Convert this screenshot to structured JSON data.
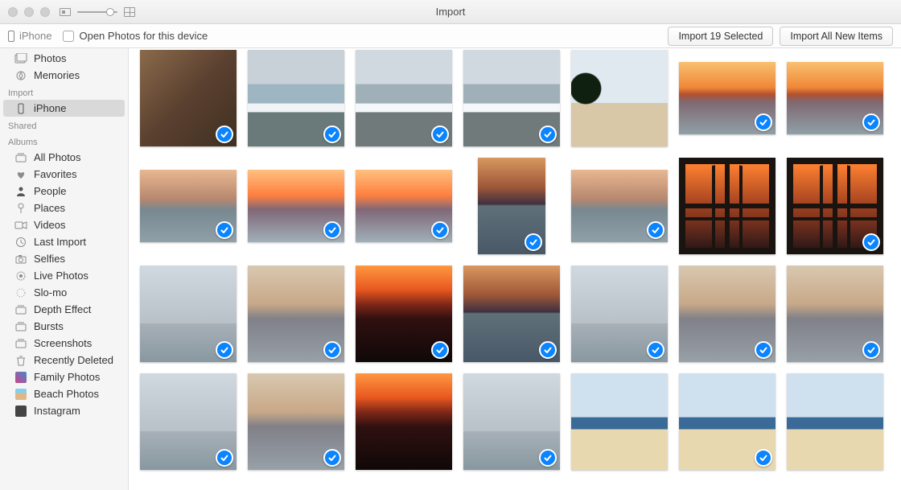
{
  "window": {
    "title": "Import"
  },
  "toolbar": {
    "device_name": "iPhone",
    "open_photos_label": "Open Photos for this device",
    "import_selected_label": "Import 19 Selected",
    "import_all_label": "Import All New Items"
  },
  "sidebar": {
    "library": {
      "items": [
        {
          "label": "Photos",
          "icon": "photos"
        },
        {
          "label": "Memories",
          "icon": "memories"
        }
      ]
    },
    "import": {
      "title": "Import",
      "items": [
        {
          "label": "iPhone",
          "icon": "phone",
          "selected": true
        }
      ]
    },
    "shared": {
      "title": "Shared"
    },
    "albums": {
      "title": "Albums",
      "items": [
        {
          "label": "All Photos",
          "icon": "stack"
        },
        {
          "label": "Favorites",
          "icon": "heart"
        },
        {
          "label": "People",
          "icon": "person"
        },
        {
          "label": "Places",
          "icon": "pin"
        },
        {
          "label": "Videos",
          "icon": "video"
        },
        {
          "label": "Last Import",
          "icon": "clock"
        },
        {
          "label": "Selfies",
          "icon": "camera"
        },
        {
          "label": "Live Photos",
          "icon": "live"
        },
        {
          "label": "Slo-mo",
          "icon": "slomo"
        },
        {
          "label": "Depth Effect",
          "icon": "stack"
        },
        {
          "label": "Bursts",
          "icon": "stack"
        },
        {
          "label": "Screenshots",
          "icon": "stack"
        },
        {
          "label": "Recently Deleted",
          "icon": "trash"
        },
        {
          "label": "Family Photos",
          "icon": "thumb-family"
        },
        {
          "label": "Beach Photos",
          "icon": "thumb-beach"
        },
        {
          "label": "Instagram",
          "icon": "thumb-plain"
        }
      ]
    }
  },
  "grid": {
    "photos": [
      {
        "style": "rock",
        "shape": "square",
        "selected": true
      },
      {
        "style": "beach-wave",
        "shape": "square",
        "selected": true
      },
      {
        "style": "beach-wave2",
        "shape": "square",
        "selected": true
      },
      {
        "style": "beach-wave2",
        "shape": "square",
        "selected": true
      },
      {
        "style": "tree",
        "shape": "square",
        "selected": false
      },
      {
        "style": "sunset-orange-sea",
        "shape": "wide",
        "selected": true
      },
      {
        "style": "sunset-orange-sea",
        "shape": "wide",
        "selected": true
      },
      {
        "style": "sunset3",
        "shape": "wide",
        "selected": true
      },
      {
        "style": "sunset2",
        "shape": "wide",
        "selected": true
      },
      {
        "style": "sunset2",
        "shape": "wide",
        "selected": true
      },
      {
        "style": "sunset-dark-sea",
        "shape": "tall",
        "selected": true
      },
      {
        "style": "sunset3",
        "shape": "wide",
        "selected": true
      },
      {
        "style": "window-view",
        "shape": "square",
        "selected": false
      },
      {
        "style": "window-view",
        "shape": "square",
        "selected": true
      },
      {
        "style": "cloud",
        "shape": "square",
        "selected": true
      },
      {
        "style": "sunset-muted",
        "shape": "square",
        "selected": true
      },
      {
        "style": "sunset-deep",
        "shape": "square",
        "selected": true
      },
      {
        "style": "sunset-dark-sea",
        "shape": "square",
        "selected": true
      },
      {
        "style": "cloud",
        "shape": "square",
        "selected": true
      },
      {
        "style": "sunset-muted",
        "shape": "square",
        "selected": true
      },
      {
        "style": "sunset-muted",
        "shape": "square",
        "selected": true
      },
      {
        "style": "cloud",
        "shape": "square",
        "selected": true
      },
      {
        "style": "sunset-muted",
        "shape": "square",
        "selected": true
      },
      {
        "style": "sunset-deep",
        "shape": "square",
        "selected": false
      },
      {
        "style": "cloud",
        "shape": "square",
        "selected": true
      },
      {
        "style": "beach-day",
        "shape": "square",
        "selected": false
      },
      {
        "style": "beach-day",
        "shape": "square",
        "selected": true
      },
      {
        "style": "beach-day",
        "shape": "square",
        "selected": false
      }
    ]
  }
}
